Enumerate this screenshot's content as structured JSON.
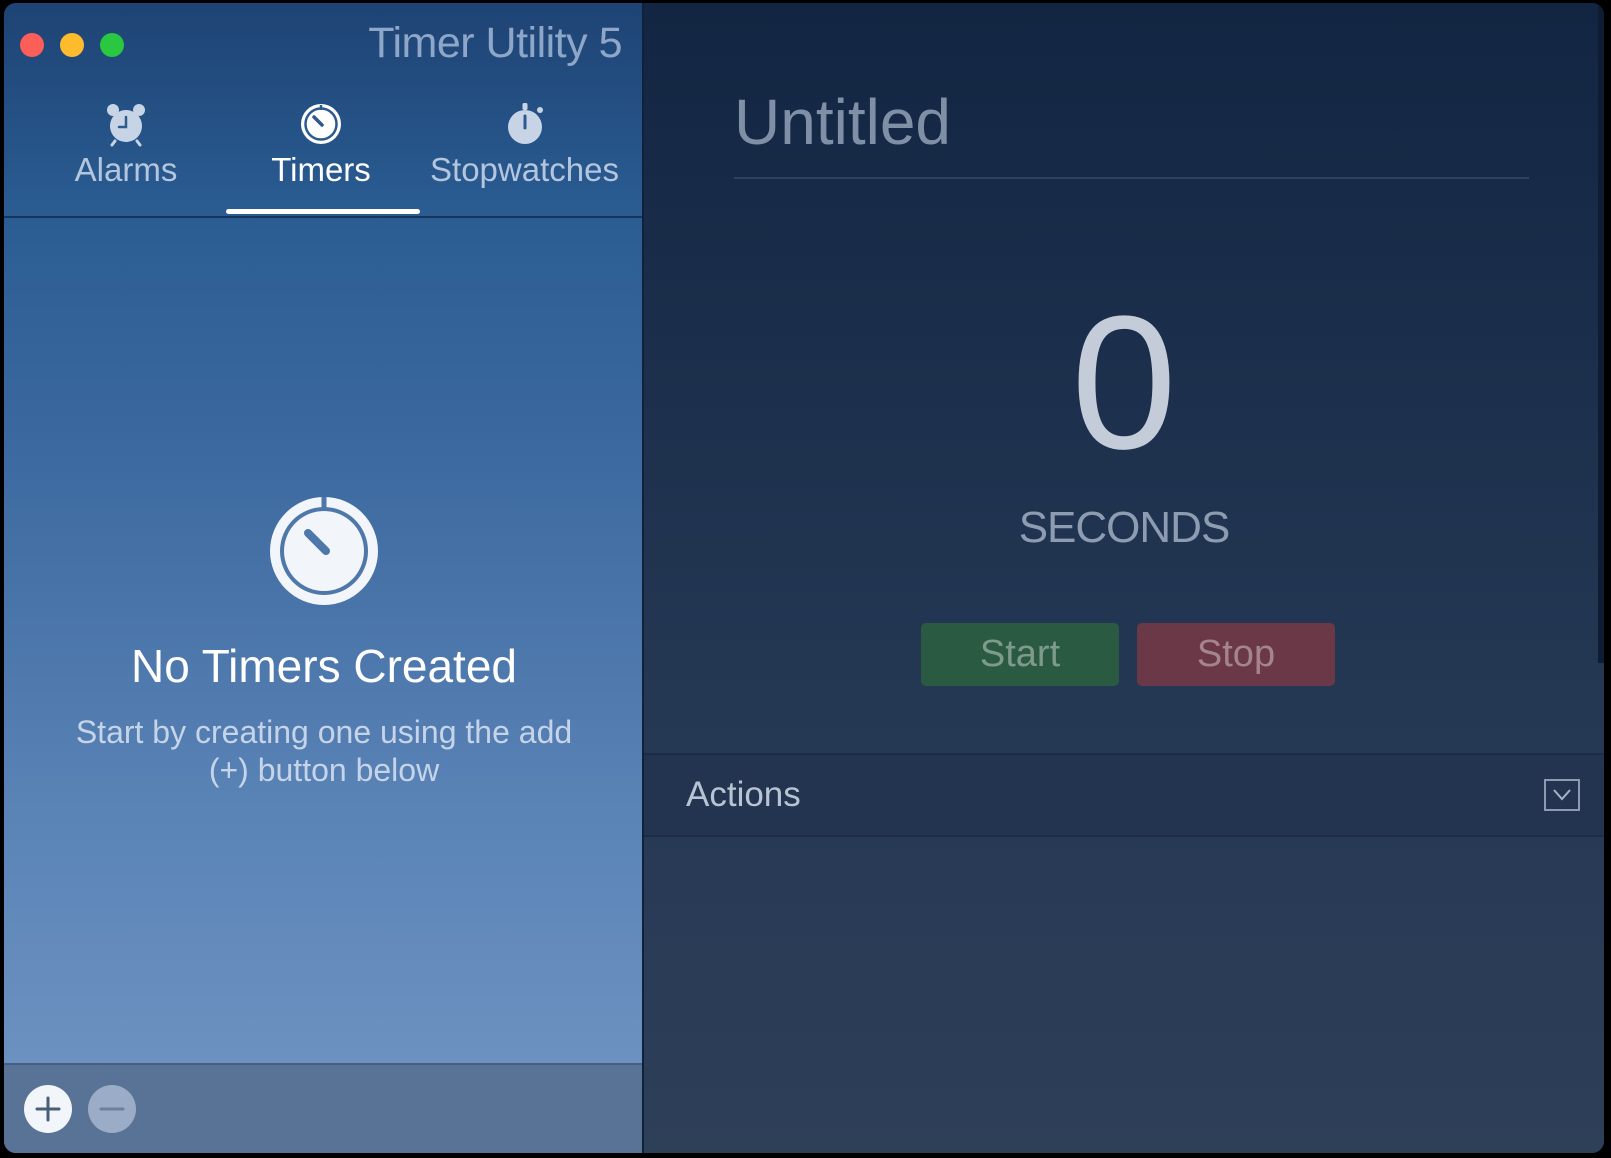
{
  "window": {
    "title": "Timer Utility 5"
  },
  "tabs": [
    {
      "label": "Alarms",
      "icon": "alarm-clock-icon"
    },
    {
      "label": "Timers",
      "icon": "timer-icon",
      "active": true
    },
    {
      "label": "Stopwatches",
      "icon": "stopwatch-icon"
    }
  ],
  "empty_state": {
    "icon": "timer-icon",
    "title": "No Timers Created",
    "subtitle": "Start by creating one using the add (+) button below"
  },
  "bottom_bar": {
    "add_icon": "plus-icon",
    "remove_icon": "minus-icon"
  },
  "detail": {
    "name": "Untitled",
    "count": "0",
    "unit": "SECONDS",
    "start_label": "Start",
    "stop_label": "Stop",
    "actions_label": "Actions"
  },
  "colors": {
    "close": "#fc5f57",
    "minimize": "#fdbc2e",
    "maximize": "#29c840",
    "start": "#2b5a43",
    "stop": "#6a3847"
  }
}
